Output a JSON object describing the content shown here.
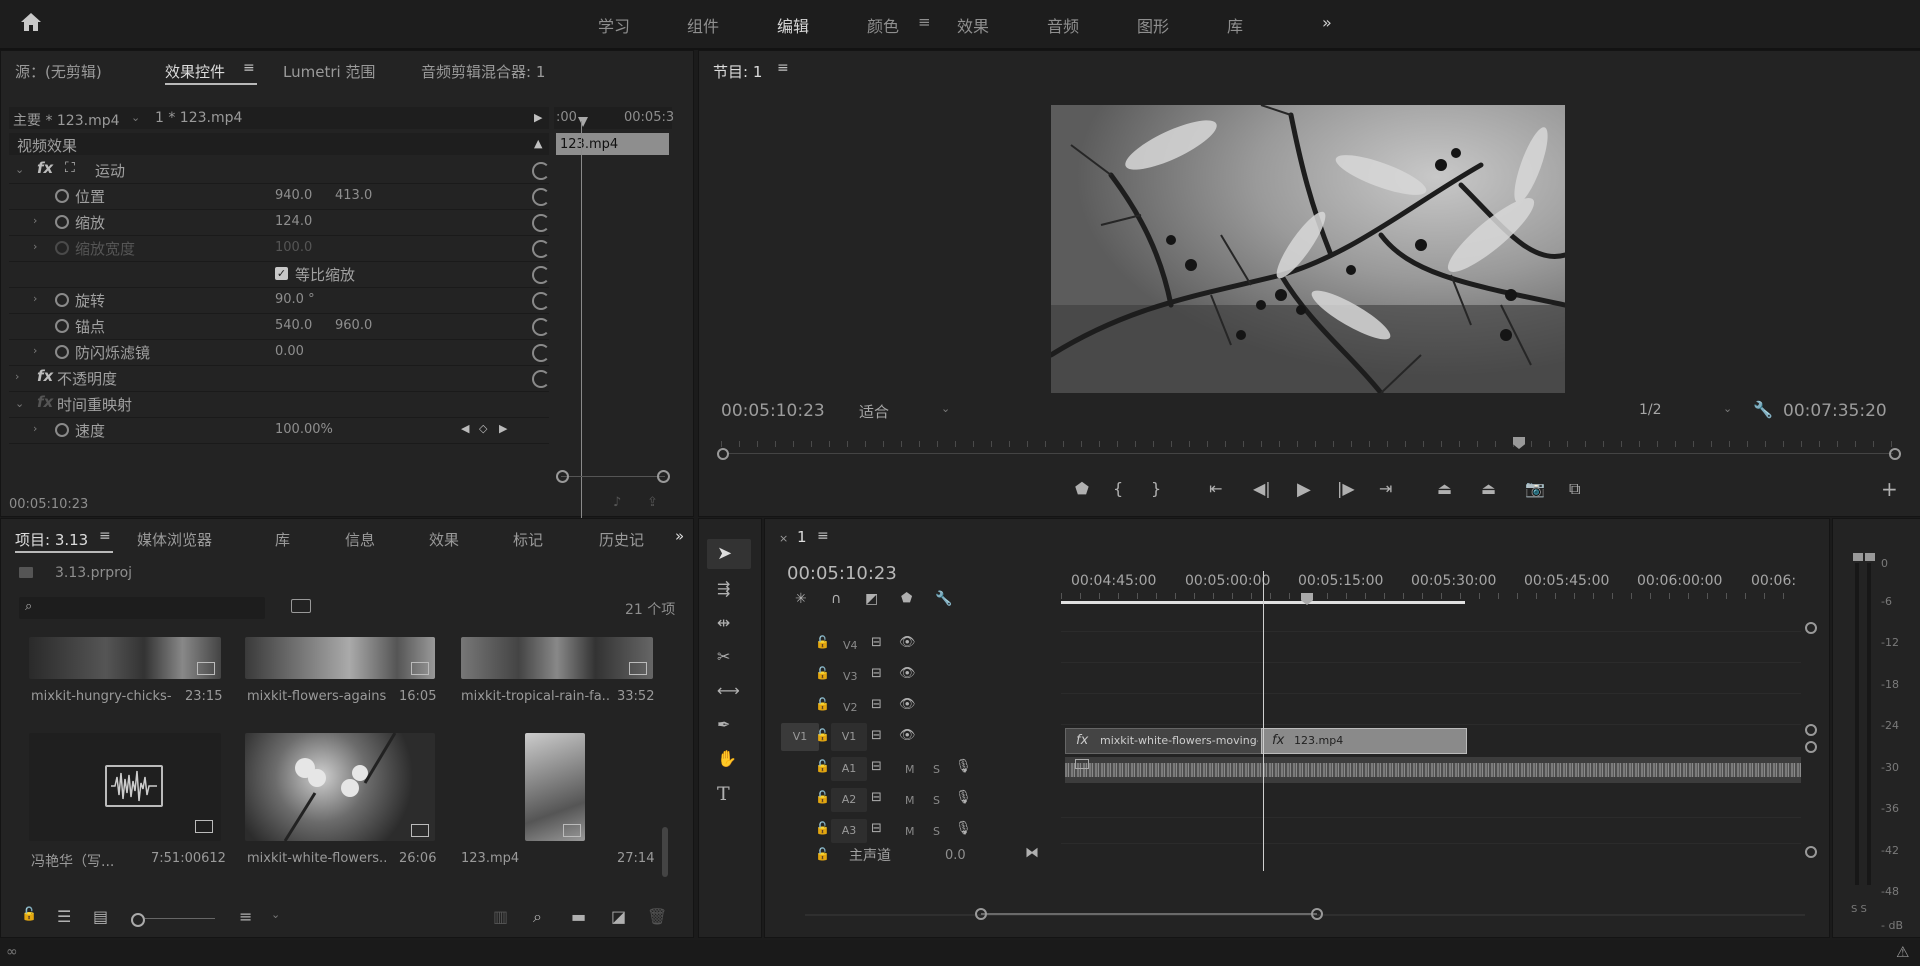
{
  "workspaces": [
    "学习",
    "组件",
    "编辑",
    "颜色",
    "效果",
    "音频",
    "图形",
    "库"
  ],
  "source_panel": {
    "tabs": [
      "源：(无剪辑)",
      "效果控件",
      "Lumetri 范围",
      "音频剪辑混合器: 1"
    ],
    "master": "主要 * 123.mp4",
    "clip": "1 * 123.mp4",
    "mini_time_start": ":00",
    "mini_time_end": "00:05:3",
    "mini_clip": "123.mp4",
    "section": "视频效果",
    "effects": [
      {
        "label": "运动"
      },
      {
        "label": "位置",
        "v1": "940.0",
        "v2": "413.0"
      },
      {
        "label": "缩放",
        "v1": "124.0"
      },
      {
        "label": "缩放宽度",
        "v1": "100.0",
        "disabled": true
      },
      {
        "label": "等比缩放"
      },
      {
        "label": "旋转",
        "v1": "90.0 °"
      },
      {
        "label": "锚点",
        "v1": "540.0",
        "v2": "960.0"
      },
      {
        "label": "防闪烁滤镜",
        "v1": "0.00"
      },
      {
        "label": "不透明度"
      },
      {
        "label": "时间重映射"
      },
      {
        "label": "速度",
        "v1": "100.00%"
      }
    ],
    "timecode": "00:05:10:23"
  },
  "program": {
    "title": "节目: 1",
    "timecode": "00:05:10:23",
    "fit": "适合",
    "quality": "1/2",
    "duration": "00:07:35:20"
  },
  "project": {
    "tabs": [
      "项目: 3.13",
      "媒体浏览器",
      "库",
      "信息",
      "效果",
      "标记",
      "历史记"
    ],
    "file": "3.13.prproj",
    "count": "21 个项",
    "items": [
      {
        "name": "mixkit-hungry-chicks-...",
        "dur": "23:15"
      },
      {
        "name": "mixkit-flowers-agains...",
        "dur": "16:05"
      },
      {
        "name": "mixkit-tropical-rain-fa...",
        "dur": "33:52"
      },
      {
        "name": "冯艳华（写...",
        "dur": "7:51:00612"
      },
      {
        "name": "mixkit-white-flowers...",
        "dur": "26:06"
      },
      {
        "name": "123.mp4",
        "dur": "27:14"
      }
    ]
  },
  "timeline": {
    "seq": "1",
    "timecode": "00:05:10:23",
    "ruler": [
      "00:04:45:00",
      "00:05:00:00",
      "00:05:15:00",
      "00:05:30:00",
      "00:05:45:00",
      "00:06:00:00",
      "00:06:"
    ],
    "tracks_v": [
      "V4",
      "V3",
      "V2",
      "V1"
    ],
    "tracks_a": [
      "A1",
      "A2",
      "A3"
    ],
    "src_patch": "V1",
    "master_label": "主声道",
    "master_val": "0.0",
    "m": "M",
    "s": "S",
    "clip1": "mixkit-white-flowers-moving-in",
    "clip2": "123.mp4"
  },
  "meter": {
    "labels": [
      "0",
      "-6",
      "-12",
      "-18",
      "-24",
      "-30",
      "-36",
      "-42",
      "-48",
      "- dB"
    ],
    "ss": "S S"
  }
}
